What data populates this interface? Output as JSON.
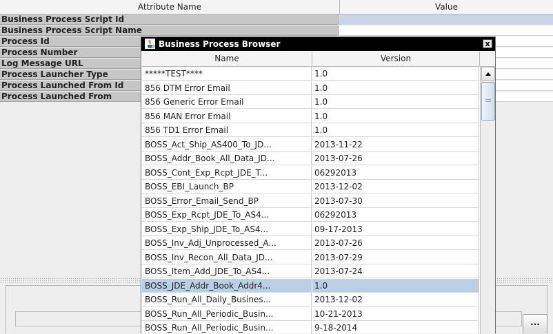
{
  "background_table": {
    "columns": [
      "Attribute Name",
      "Value"
    ],
    "rows": [
      "Business Process Script Id",
      "Business Process Script Name",
      "Process Id",
      "Process Number",
      "Log Message URL",
      "Process Launcher Type",
      "Process Launched From Id",
      "Process Launched From"
    ]
  },
  "bottom": {
    "browse_button_label": "..."
  },
  "dialog": {
    "title": "Business Process Browser",
    "close_label": "x",
    "columns": [
      "Name",
      "Version"
    ],
    "selected_index": 15,
    "rows": [
      {
        "name": "*****TEST****",
        "version": "1.0"
      },
      {
        "name": "856 DTM Error Email",
        "version": "1.0"
      },
      {
        "name": "856 Generic Error Email",
        "version": "1.0"
      },
      {
        "name": "856 MAN Error Email",
        "version": "1.0"
      },
      {
        "name": "856 TD1 Error Email",
        "version": "1.0"
      },
      {
        "name": "BOSS_Act_Ship_AS400_To_JD...",
        "version": "2013-11-22"
      },
      {
        "name": "BOSS_Addr_Book_All_Data_JD...",
        "version": "2013-07-26"
      },
      {
        "name": "BOSS_Cont_Exp_Rcpt_JDE_T...",
        "version": "06292013"
      },
      {
        "name": "BOSS_EBI_Launch_BP",
        "version": "2013-12-02"
      },
      {
        "name": "BOSS_Error_Email_Send_BP",
        "version": "2013-07-30"
      },
      {
        "name": "BOSS_Exp_Rcpt_JDE_To_AS4...",
        "version": "06292013"
      },
      {
        "name": "BOSS_Exp_Ship_JDE_To_AS4...",
        "version": "09-17-2013"
      },
      {
        "name": "BOSS_Inv_Adj_Unprocessed_A...",
        "version": "2013-07-26"
      },
      {
        "name": "BOSS_Inv_Recon_All_Data_JD...",
        "version": "2013-07-29"
      },
      {
        "name": "BOSS_Item_Add_JDE_To_AS4...",
        "version": "2013-07-24"
      },
      {
        "name": "BOSS_JDE_Addr_Book_Addr4...",
        "version": "1.0"
      },
      {
        "name": "BOSS_Run_All_Daily_Busines...",
        "version": "2013-12-02"
      },
      {
        "name": "BOSS_Run_All_Periodic_Busin...",
        "version": "10-21-2013"
      },
      {
        "name": "BOSS_Run_All_Periodic_Busin...",
        "version": "9-18-2014"
      }
    ]
  }
}
